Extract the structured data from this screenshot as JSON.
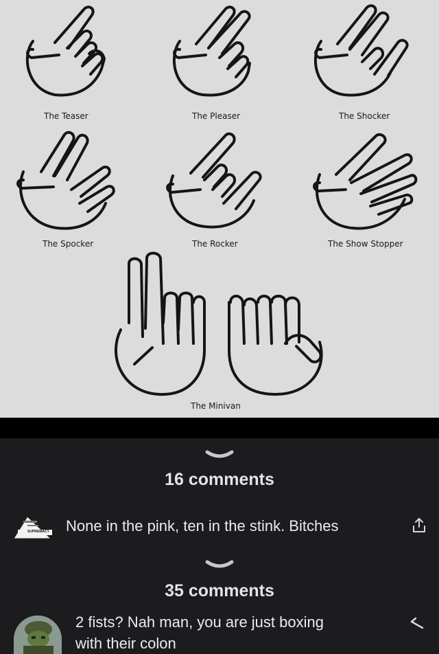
{
  "meme": {
    "captions": [
      "The Teaser",
      "The Pleaser",
      "The Shocker",
      "The Spocker",
      "The Rocker",
      "The Show Stopper",
      "The Minivan"
    ]
  },
  "comments": [
    {
      "count_label": "16 comments",
      "text": "None in the pink, ten in the stink. Bitches",
      "avatar_text": "SUPREMACY",
      "action_icon": "share-icon"
    },
    {
      "count_label": "35 comments",
      "text": "2 fists? Nah man, you are just boxing with their colon",
      "avatar_text": "",
      "action_icon": "reply-icon"
    }
  ],
  "colors": {
    "background": "#1c1c1e",
    "text": "#ececee",
    "count": "#e4e4e6",
    "chevron": "#c8c8cc",
    "meme_bg": "#dcdcdc"
  }
}
